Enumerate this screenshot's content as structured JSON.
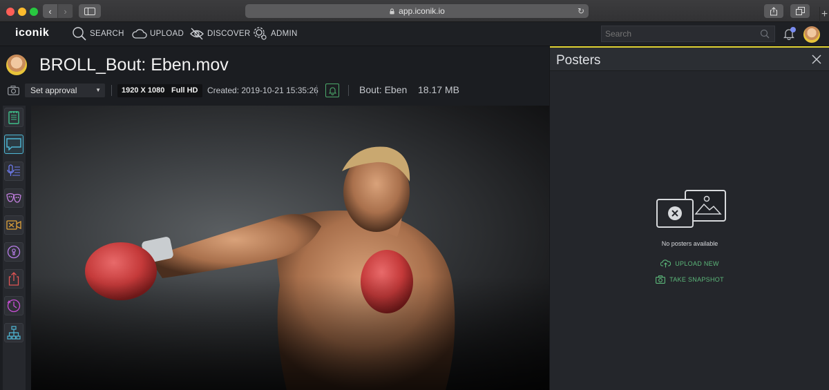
{
  "browser": {
    "url": "app.iconik.io"
  },
  "app": {
    "logo": "iconik",
    "menu": [
      {
        "label": "SEARCH",
        "icon": "search-icon"
      },
      {
        "label": "UPLOAD",
        "icon": "cloud-upload-icon"
      },
      {
        "label": "DISCOVER",
        "icon": "discover-icon"
      },
      {
        "label": "ADMIN",
        "icon": "gear-icon"
      }
    ],
    "search_placeholder": "Search"
  },
  "asset": {
    "title": "BROLL_Bout: Eben.mov",
    "approval_label": "Set approval",
    "resolution": "1920 X 1080",
    "quality": "Full HD",
    "created": "Created: 2019-10-21 15:35:26",
    "collection": "Bout: Eben",
    "file_size": "18.17 MB"
  },
  "rail": [
    {
      "icon": "metadata-notes-icon",
      "color": "#3fbf8a"
    },
    {
      "icon": "comments-icon",
      "color": "#4fb8d6",
      "active": true
    },
    {
      "icon": "transcription-icon",
      "color": "#6e7cf0"
    },
    {
      "icon": "faces-masks-icon",
      "color": "#c27fe0"
    },
    {
      "icon": "video-segments-icon",
      "color": "#e0a23a"
    },
    {
      "icon": "permissions-lock-icon",
      "color": "#b77de8"
    },
    {
      "icon": "export-share-icon",
      "color": "#e25555"
    },
    {
      "icon": "history-clock-icon",
      "color": "#c84fd6"
    },
    {
      "icon": "relations-tree-icon",
      "color": "#4fb8d6"
    }
  ],
  "panel": {
    "title": "Posters",
    "empty_text": "No posters available",
    "upload_label": "UPLOAD NEW",
    "snapshot_label": "TAKE SNAPSHOT"
  },
  "colors": {
    "accent": "#e2d434",
    "action_green": "#5cb87a"
  }
}
